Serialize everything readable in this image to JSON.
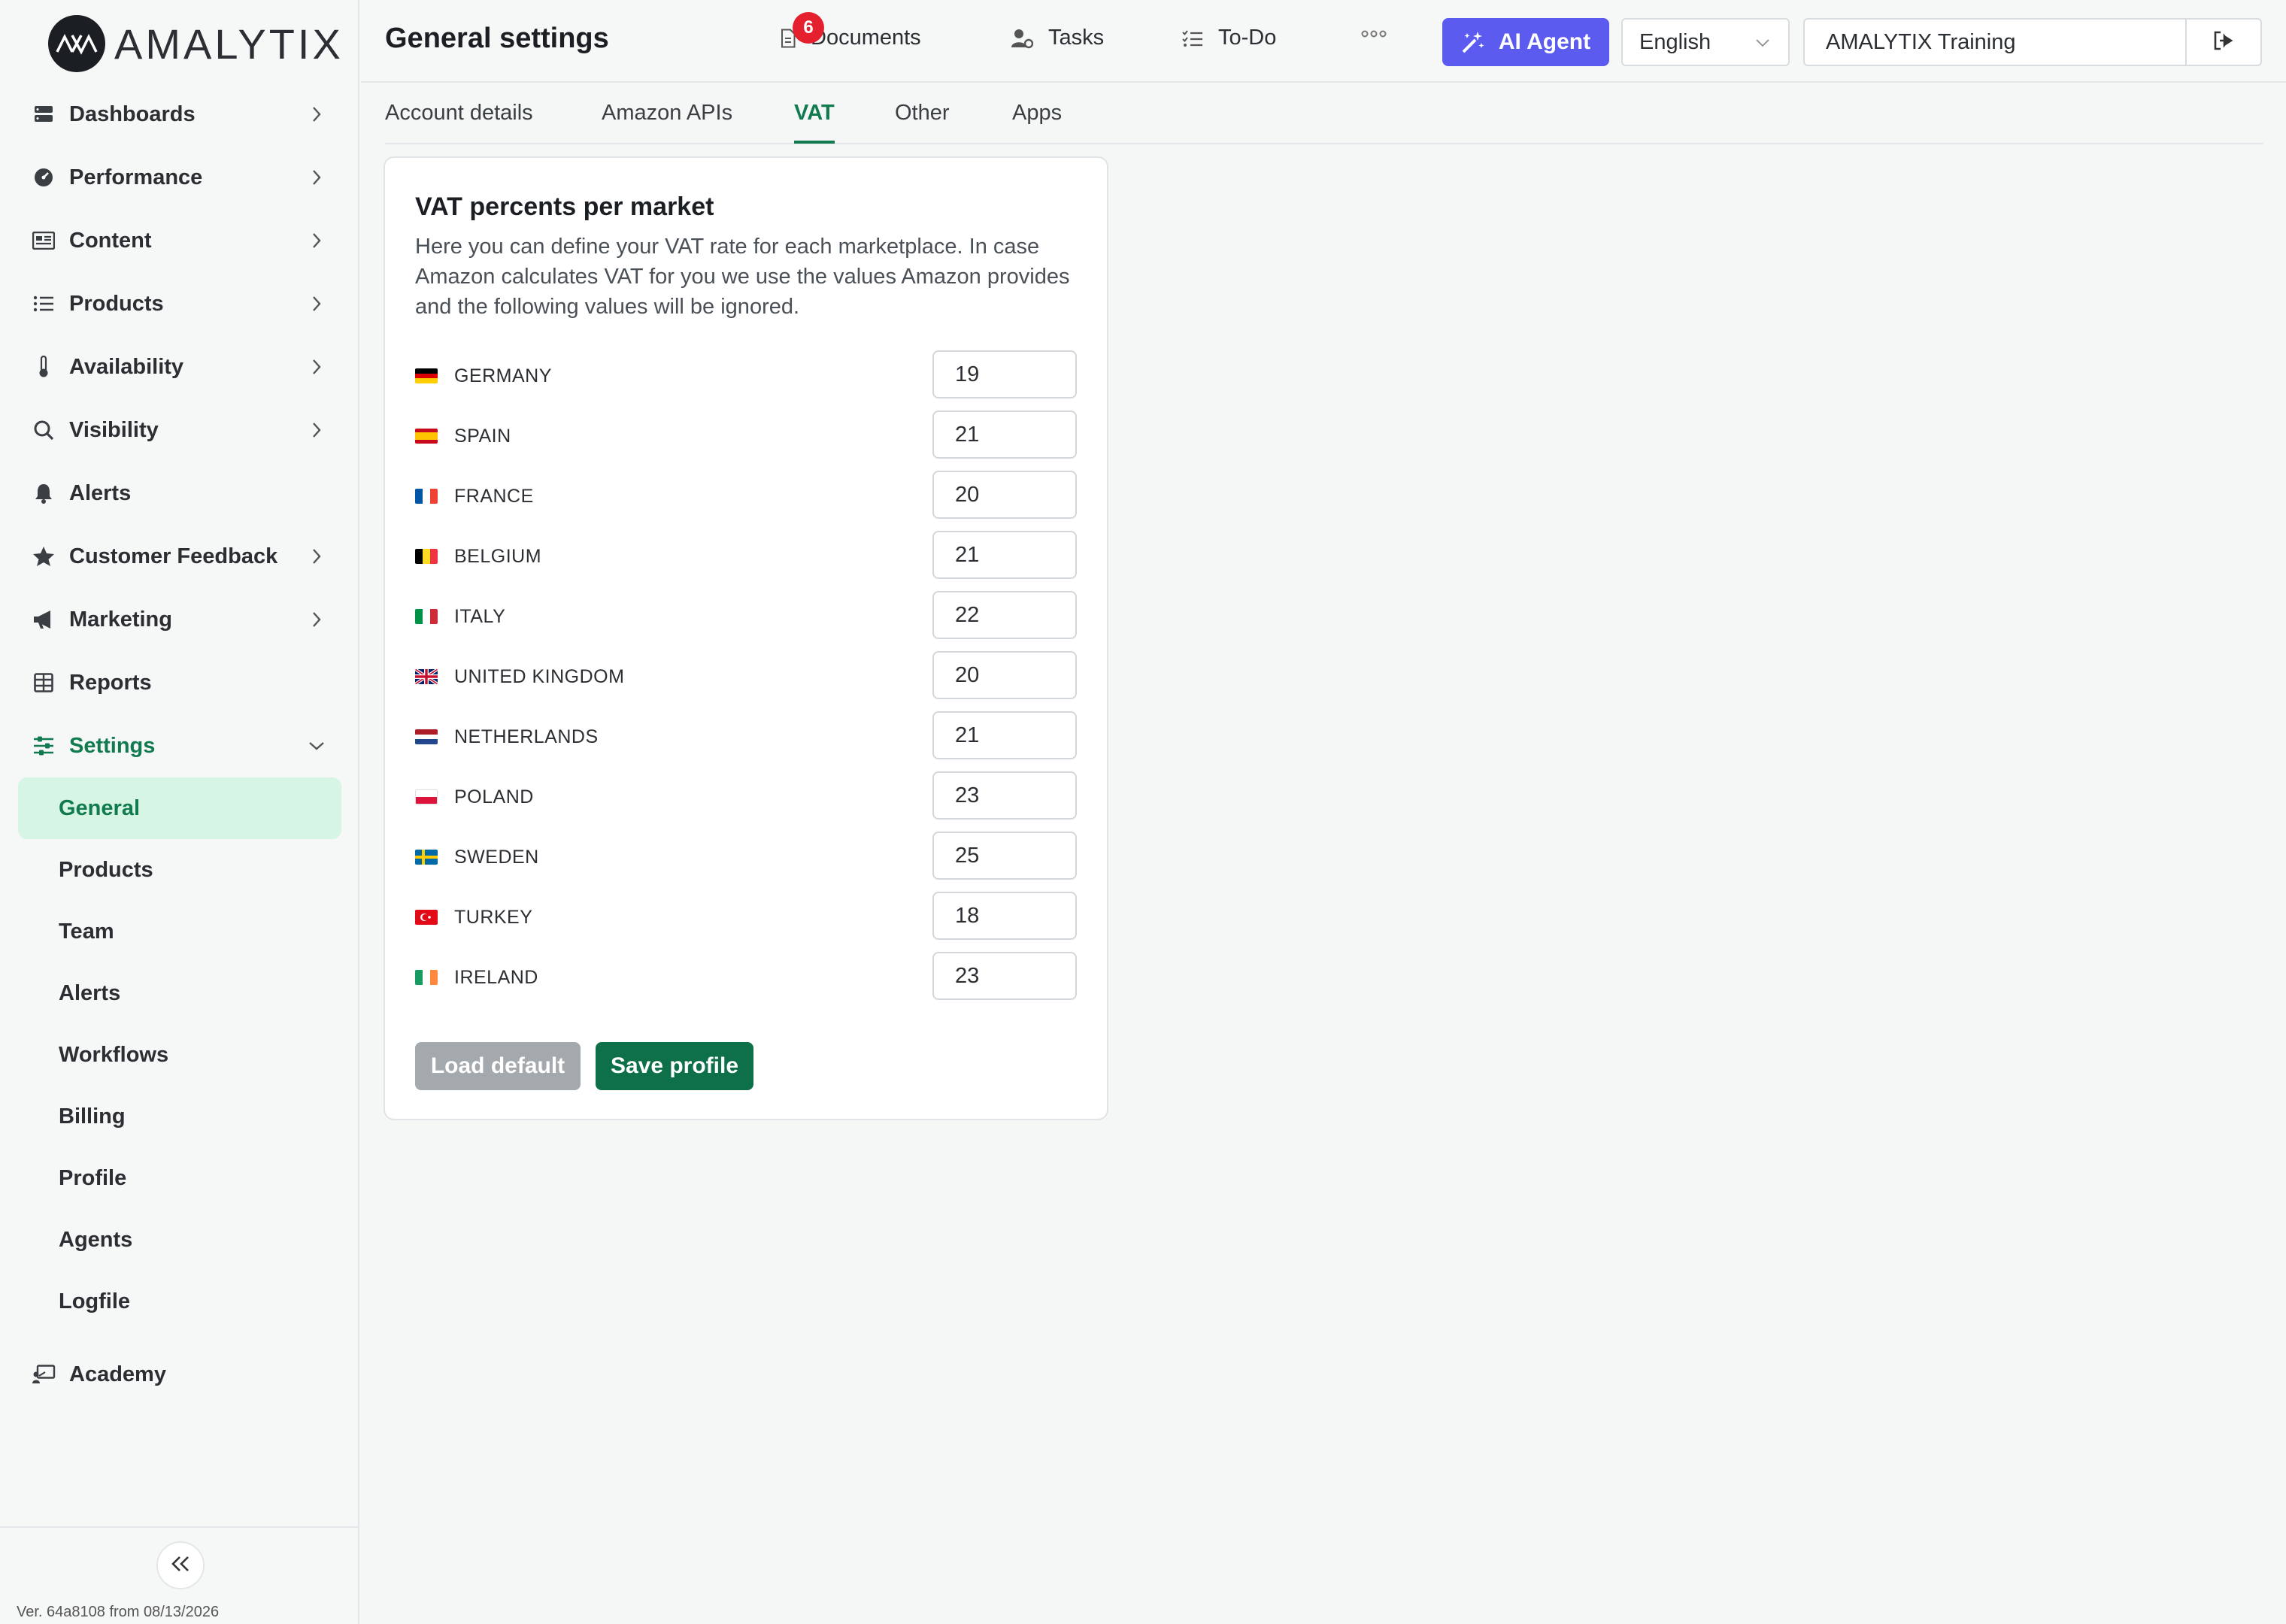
{
  "app": {
    "logo_text": "AMALYTIX",
    "version": "Ver. 64a8108 from 08/13/2026"
  },
  "sidebar": {
    "items": [
      {
        "label": "Dashboards",
        "icon": "dashboard-icon"
      },
      {
        "label": "Performance",
        "icon": "gauge-icon"
      },
      {
        "label": "Content",
        "icon": "content-icon"
      },
      {
        "label": "Products",
        "icon": "list-icon"
      },
      {
        "label": "Availability",
        "icon": "thermometer-icon"
      },
      {
        "label": "Visibility",
        "icon": "search-icon"
      },
      {
        "label": "Alerts",
        "icon": "bell-icon"
      },
      {
        "label": "Customer Feedback",
        "icon": "star-icon"
      },
      {
        "label": "Marketing",
        "icon": "megaphone-icon"
      },
      {
        "label": "Reports",
        "icon": "table-icon"
      },
      {
        "label": "Settings",
        "icon": "sliders-icon"
      },
      {
        "label": "Academy",
        "icon": "academy-icon"
      }
    ],
    "settings_sub": [
      "General",
      "Products",
      "Team",
      "Alerts",
      "Workflows",
      "Billing",
      "Profile",
      "Agents",
      "Logfile"
    ]
  },
  "header": {
    "title": "General settings",
    "documents_label": "Documents",
    "documents_badge": "6",
    "tasks_label": "Tasks",
    "todo_label": "To-Do",
    "ai_label": "AI Agent",
    "language": "English",
    "account": "AMALYTIX Training"
  },
  "tabs": [
    "Account details",
    "Amazon APIs",
    "VAT",
    "Other",
    "Apps"
  ],
  "vat": {
    "title": "VAT percents per market",
    "description": "Here you can define your VAT rate for each marketplace. In case Amazon calculates VAT for you we use the values Amazon provides and the following values will be ignored.",
    "markets": [
      {
        "country": "GERMANY",
        "value": "19"
      },
      {
        "country": "SPAIN",
        "value": "21"
      },
      {
        "country": "FRANCE",
        "value": "20"
      },
      {
        "country": "BELGIUM",
        "value": "21"
      },
      {
        "country": "ITALY",
        "value": "22"
      },
      {
        "country": "UNITED KINGDOM",
        "value": "20"
      },
      {
        "country": "NETHERLANDS",
        "value": "21"
      },
      {
        "country": "POLAND",
        "value": "23"
      },
      {
        "country": "SWEDEN",
        "value": "25"
      },
      {
        "country": "TURKEY",
        "value": "18"
      },
      {
        "country": "IRELAND",
        "value": "23"
      }
    ],
    "load_default_label": "Load default",
    "save_label": "Save profile"
  },
  "colors": {
    "accent": "#117a4e",
    "ai": "#5b5bf0",
    "badge": "#e5202e",
    "selected_bg": "#d7f5e4"
  }
}
